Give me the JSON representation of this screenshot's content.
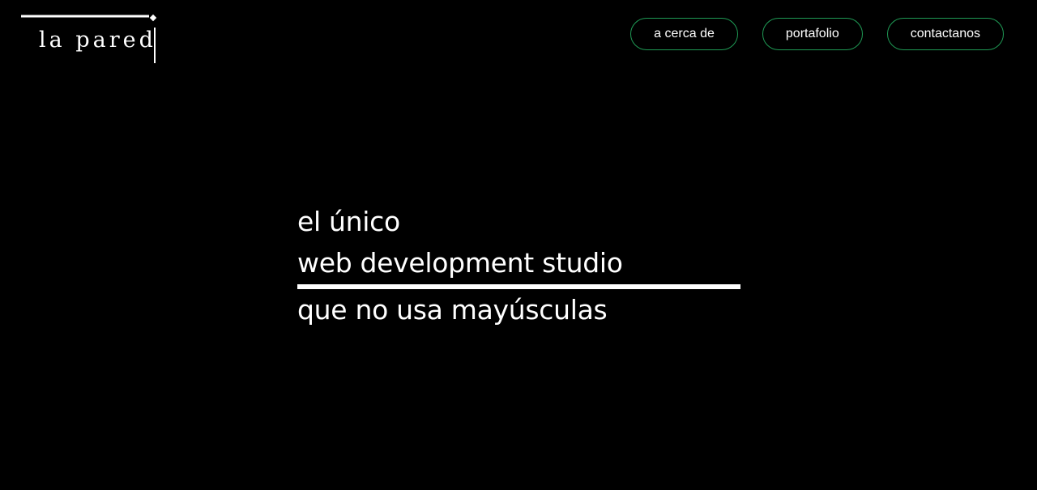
{
  "header": {
    "logo": {
      "text": "la pared",
      "icon": "wall-bracket-logo-icon"
    },
    "nav": [
      {
        "label": "a cerca de"
      },
      {
        "label": "portafolio"
      },
      {
        "label": "contactanos"
      }
    ]
  },
  "hero": {
    "line1": "el único",
    "line2": "web development studio",
    "line3": "que no usa mayúsculas"
  },
  "colors": {
    "background": "#000000",
    "text": "#ffffff",
    "nav_border": "#1f9a55"
  }
}
